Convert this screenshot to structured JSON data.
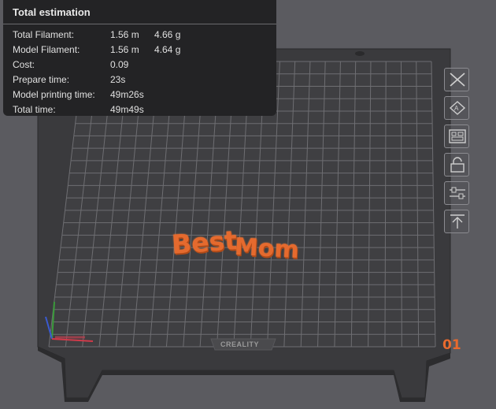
{
  "estimation": {
    "title": "Total estimation",
    "rows": [
      {
        "label": "Total Filament:",
        "value1": "1.56 m",
        "value2": "4.66 g"
      },
      {
        "label": "Model Filament:",
        "value1": "1.56 m",
        "value2": "4.64 g"
      },
      {
        "label": "Cost:",
        "value1": "0.09",
        "value2": ""
      },
      {
        "label": "Prepare time:",
        "value1": "23s",
        "value2": ""
      },
      {
        "label": "Model printing time:",
        "value1": "49m26s",
        "value2": ""
      },
      {
        "label": "Total time:",
        "value1": "49m49s",
        "value2": ""
      }
    ]
  },
  "plate": {
    "number": "01",
    "brand": "CREALITY"
  },
  "model": {
    "text_part1": "Best",
    "text_part2": "Mom",
    "color": "#e56a2e"
  },
  "toolbar": {
    "icons": [
      "close-icon",
      "auto-orient-icon",
      "arrange-icon",
      "lock-icon",
      "settings-sliders-icon",
      "move-to-top-icon"
    ]
  },
  "colors": {
    "background": "#5b5b60",
    "plate": "#3a3a3d",
    "grid": "#6e6e72",
    "accent": "#e86a2e"
  }
}
